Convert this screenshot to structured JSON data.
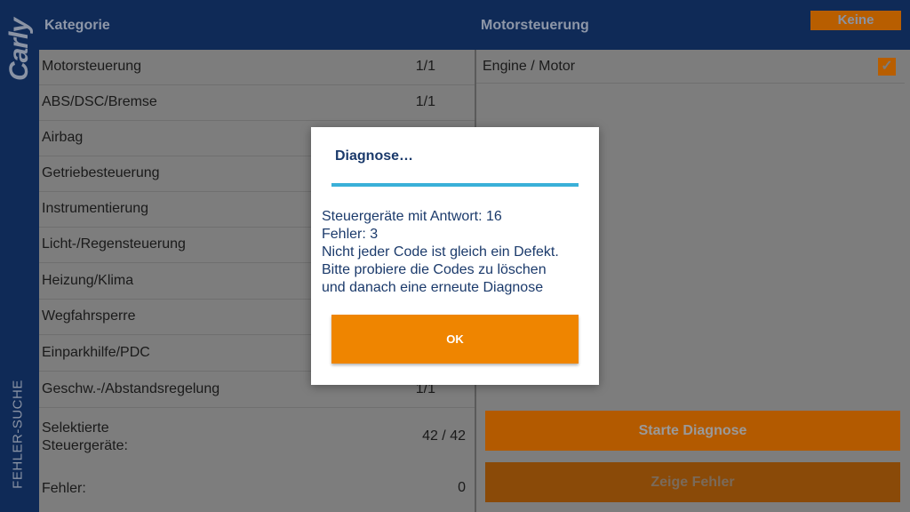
{
  "brand": {
    "logo_text": "Carly"
  },
  "side_tab": {
    "label": "FEHLER-SUCHE"
  },
  "header": {
    "left_title": "Kategorie",
    "right_title": "Motorsteuerung",
    "none_button_label": "Keine"
  },
  "categories": [
    {
      "label": "Motorsteuerung",
      "count": "1/1"
    },
    {
      "label": "ABS/DSC/Bremse",
      "count": "1/1"
    },
    {
      "label": "Airbag",
      "count": ""
    },
    {
      "label": "Getriebesteuerung",
      "count": ""
    },
    {
      "label": "Instrumentierung",
      "count": ""
    },
    {
      "label": "Licht-/Regensteuerung",
      "count": ""
    },
    {
      "label": "Heizung/Klima",
      "count": ""
    },
    {
      "label": "Wegfahrsperre",
      "count": ""
    },
    {
      "label": "Einparkhilfe/PDC",
      "count": ""
    },
    {
      "label": "Geschw.-/Abstandsregelung",
      "count": "1/1"
    }
  ],
  "summary": {
    "selected_label_line1": "Selektierte",
    "selected_label_line2": "Steuergeräte:",
    "selected_value": "42  / 42",
    "errors_label": "Fehler:",
    "errors_value": "0"
  },
  "right_panel": {
    "ecu_label": "Engine / Motor",
    "ecu_checked": true,
    "start_button_label": "Starte Diagnose",
    "show_button_label": "Zeige Fehler"
  },
  "dialog": {
    "title": "Diagnose…",
    "progress": 1.0,
    "message_lines": [
      "Steuergeräte mit Antwort: 16",
      "Fehler: 3",
      "Nicht jeder Code ist gleich ein Defekt.",
      "Bitte probiere die Codes zu löschen",
      "und danach eine erneute Diagnose"
    ],
    "ok_label": "OK"
  },
  "colors": {
    "navy": "#0f2a57",
    "orange": "#ef8500",
    "progress_blue": "#3ab0d8",
    "dialog_text": "#1b3a6b"
  }
}
